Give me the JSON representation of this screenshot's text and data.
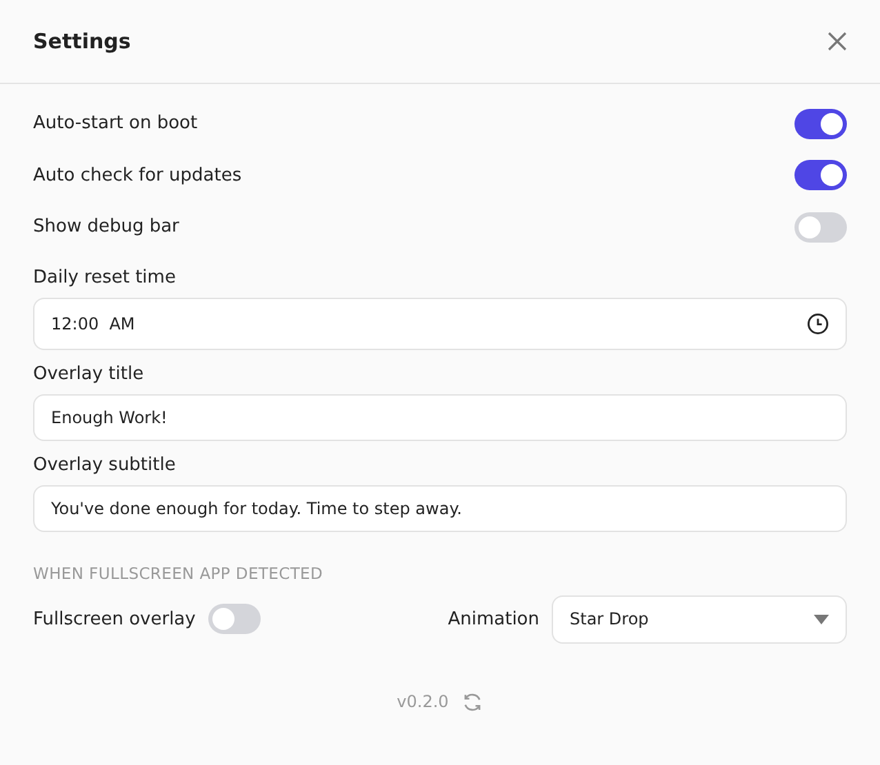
{
  "window": {
    "title": "Settings"
  },
  "toggles": [
    {
      "label": "Auto-start on boot",
      "on": true
    },
    {
      "label": "Auto check for updates",
      "on": true
    },
    {
      "label": "Show debug bar",
      "on": false
    }
  ],
  "fields": [
    {
      "label": "Daily reset time",
      "value": "12:00  AM",
      "kind": "time"
    },
    {
      "label": "Overlay title",
      "value": "Enough Work!",
      "kind": "text"
    },
    {
      "label": "Overlay subtitle",
      "value": "You've done enough for today. Time to step away.",
      "kind": "text"
    }
  ],
  "fullscreen_section": {
    "heading": "WHEN FULLSCREEN APP DETECTED",
    "overlay_label": "Fullscreen overlay",
    "overlay_on": false,
    "animation_label": "Animation",
    "animation_value": "Star Drop"
  },
  "footer": {
    "version": "v0.2.0"
  }
}
